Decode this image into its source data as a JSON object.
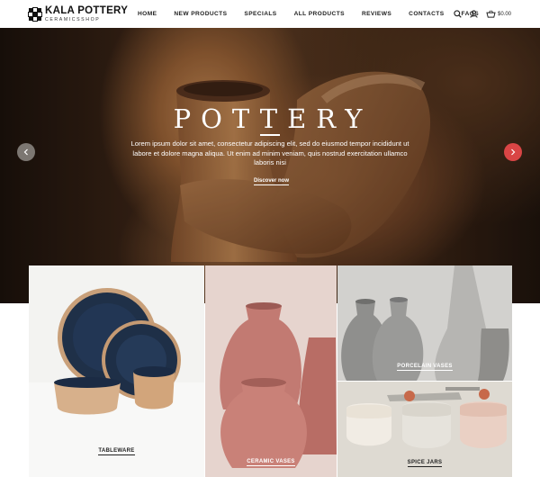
{
  "brand": {
    "title": "KALA POTTERY",
    "subtitle": "CERAMICSSHOP"
  },
  "nav": {
    "items": [
      "HOME",
      "NEW PRODUCTS",
      "SPECIALS",
      "ALL PRODUCTS",
      "REVIEWS",
      "CONTACTS",
      "FAQS"
    ]
  },
  "header_tools": {
    "search_icon": "search-icon",
    "account_icon": "user-icon",
    "cart_icon": "basket-icon",
    "cart_total": "$0.00"
  },
  "hero": {
    "title": "POTTERY",
    "text": "Lorem ipsum dolor sit amet, consectetur adipiscing elit, sed do eiusmod tempor incididunt ut labore et dolore magna aliqua. Ut enim ad minim veniam, quis nostrud exercitation ullamco laboris nisi",
    "cta": "Discover now",
    "prev_icon": "chevron-left-icon",
    "next_icon": "chevron-right-icon"
  },
  "categories": [
    {
      "label": "TABLEWARE"
    },
    {
      "label": "CERAMIC VASES"
    },
    {
      "label": "PORCELAIN VASES"
    },
    {
      "label": "SPICE JARS"
    }
  ],
  "colors": {
    "accent": "#d94545",
    "text": "#222222",
    "slider_prev": "#7c7772"
  }
}
